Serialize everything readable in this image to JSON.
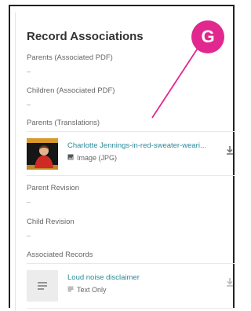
{
  "title": "Record Associations",
  "sections": [
    {
      "label": "Parents (Associated PDF)",
      "empty": "–"
    },
    {
      "label": "Children (Associated PDF)",
      "empty": "–"
    },
    {
      "label": "Parents (Translations)"
    },
    {
      "label": "Parent Revision",
      "empty": "–"
    },
    {
      "label": "Child Revision",
      "empty": "–"
    },
    {
      "label": "Associated Records"
    }
  ],
  "records": [
    {
      "name": "Charlotte Jennings-in-red-sweater-weari...",
      "type": "Image (JPG)",
      "icon": "image-icon"
    },
    {
      "name": "Loud noise disclaimer",
      "type": "Text Only",
      "icon": "text-icon"
    }
  ],
  "badge": {
    "letter": "G",
    "color": "#e0288e"
  },
  "accent": "#2a8b9b"
}
